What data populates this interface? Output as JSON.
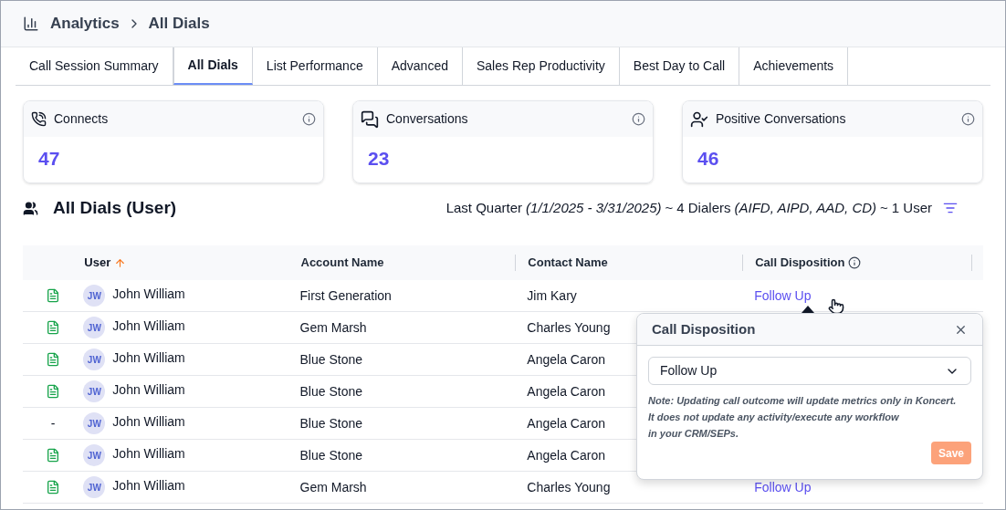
{
  "breadcrumb": {
    "section": "Analytics",
    "page": "All Dials"
  },
  "tabs": [
    {
      "label": "Call Session Summary",
      "selected": false
    },
    {
      "label": "All Dials",
      "selected": true
    },
    {
      "label": "List Performance",
      "selected": false
    },
    {
      "label": "Advanced",
      "selected": false
    },
    {
      "label": "Sales Rep Productivity",
      "selected": false
    },
    {
      "label": "Best Day to Call",
      "selected": false
    },
    {
      "label": "Achievements",
      "selected": false
    }
  ],
  "metrics": [
    {
      "kind": "phone",
      "label": "Connects",
      "value": "47"
    },
    {
      "kind": "chat",
      "label": "Conversations",
      "value": "23"
    },
    {
      "kind": "user-check",
      "label": "Positive Conversations",
      "value": "46"
    }
  ],
  "section": {
    "title": "All Dials (User)",
    "period": "Last Quarter",
    "range": "(1/1/2025 - 3/31/2025)",
    "separator_1": "~",
    "dialers": "4 Dialers",
    "dialer_codes": "(AIFD, AIPD, AAD, CD)",
    "separator_2": "~",
    "users": "1 User"
  },
  "table": {
    "columns": [
      {
        "label": "User",
        "sorted": true
      },
      {
        "label": "Account Name",
        "sorted": false
      },
      {
        "label": "Contact Name",
        "sorted": false
      },
      {
        "label": "Call Disposition",
        "sorted": false
      }
    ],
    "rows": [
      {
        "note": "",
        "has_note": true,
        "initials": "JW",
        "user": "John William",
        "account": "First Generation",
        "contact": "Jim Kary",
        "disposition": "Follow Up"
      },
      {
        "note": "",
        "has_note": true,
        "initials": "JW",
        "user": "John William",
        "account": "Gem Marsh",
        "contact": "Charles Young"
      },
      {
        "note": "",
        "has_note": true,
        "initials": "JW",
        "user": "John William",
        "account": "Blue Stone",
        "contact": "Angela Caron"
      },
      {
        "note": "",
        "has_note": true,
        "initials": "JW",
        "user": "John William",
        "account": "Blue Stone",
        "contact": "Angela Caron"
      },
      {
        "note": "-",
        "has_note": false,
        "initials": "JW",
        "user": "John William",
        "account": "Blue Stone",
        "contact": "Angela Caron"
      },
      {
        "note": "",
        "has_note": true,
        "initials": "JW",
        "user": "John William",
        "account": "Blue Stone",
        "contact": "Angela Caron"
      },
      {
        "note": "",
        "has_note": true,
        "initials": "JW",
        "user": "John William",
        "account": "Gem Marsh",
        "contact": "Charles Young",
        "disposition": "Follow Up"
      }
    ]
  },
  "popover": {
    "title": "Call Disposition",
    "select_value": "Follow Up",
    "note_lines": [
      "Note: Updating call outcome will update metrics only in Koncert.",
      "It does not update any activity/execute any workflow",
      "in your CRM/SEPs."
    ],
    "save_label": "Save",
    "save_disabled": true
  }
}
